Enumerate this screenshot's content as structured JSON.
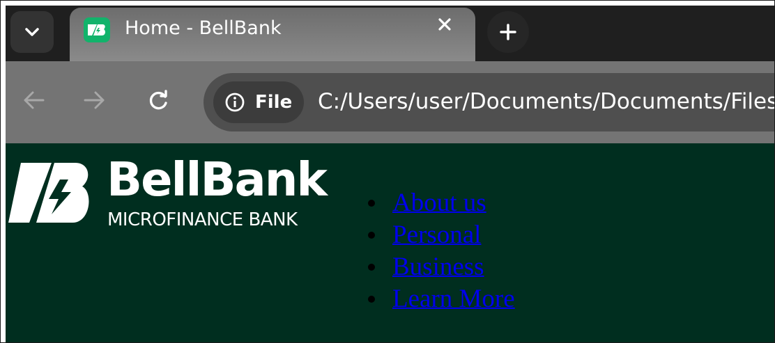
{
  "browser": {
    "tab": {
      "title": "Home - BellBank",
      "favicon": "bellbank-logo-icon"
    },
    "address_bar": {
      "site_info_label": "File",
      "url": "C:/Users/user/Documents/Documents/Files"
    },
    "icons": {
      "tab_search": "chevron-down-icon",
      "close_tab": "close-icon",
      "new_tab": "plus-icon",
      "back": "arrow-left-icon",
      "forward": "arrow-right-icon",
      "reload": "reload-icon",
      "site_info": "info-icon"
    }
  },
  "page": {
    "background_color": "#002e1f",
    "link_color": "#0000ee",
    "logo": {
      "name": "BellBank",
      "tagline": "MICROFINANCE BANK"
    },
    "nav": {
      "items": [
        {
          "label": "About us"
        },
        {
          "label": "Personal"
        },
        {
          "label": "Business"
        },
        {
          "label": "Learn More"
        }
      ]
    }
  }
}
